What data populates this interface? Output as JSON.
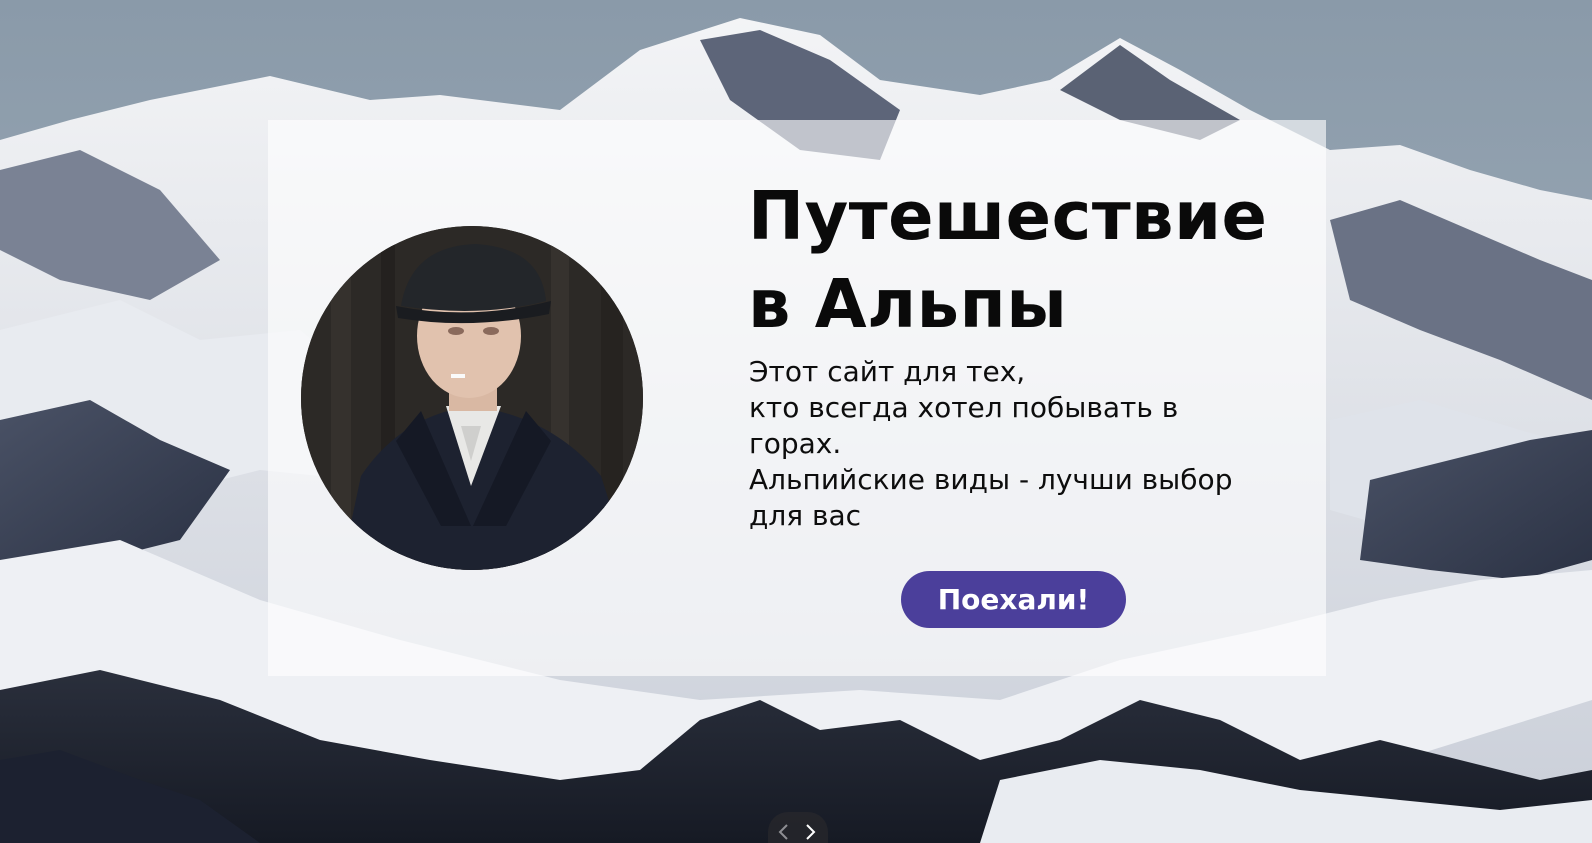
{
  "hero": {
    "title_line1": "Путешествие",
    "title_line2": "в Альпы",
    "description_lines": [
      "Этот сайт для тех,",
      "кто всегда хотел побывать в",
      "горах.",
      "Альпийские виды - лучши выбор",
      "для вас"
    ],
    "cta_label": "Поехали!"
  },
  "slider": {
    "prev_icon": "chevron-left-icon",
    "next_icon": "chevron-right-icon"
  },
  "colors": {
    "button": "#4b3f9b",
    "card_overlay": "#ffffff",
    "sky": "#8d9caa"
  }
}
